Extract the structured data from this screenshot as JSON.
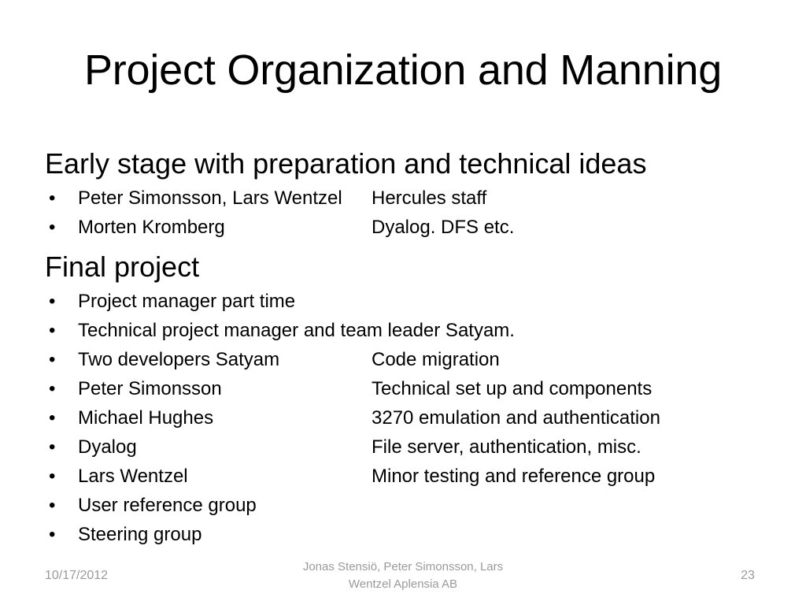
{
  "slide": {
    "title": "Project Organization and Manning",
    "sections": [
      {
        "heading": "Early stage with preparation and technical ideas",
        "bullets": [
          {
            "bullet": "•",
            "col_a": "Peter Simonsson, Lars Wentzel",
            "col_b": "Hercules staff"
          },
          {
            "bullet": "•",
            "col_a": "Morten Kromberg",
            "col_b": "Dyalog. DFS etc."
          }
        ]
      },
      {
        "heading": "Final project",
        "bullets": [
          {
            "bullet": "•",
            "col_a": "Project manager part time",
            "col_b": ""
          },
          {
            "bullet": "•",
            "col_a": "Technical project manager and team leader Satyam.",
            "col_b": ""
          },
          {
            "bullet": "•",
            "col_a": "Two developers Satyam",
            "col_b": "Code migration"
          },
          {
            "bullet": "•",
            "col_a": "Peter Simonsson",
            "col_b": "Technical set up and components"
          },
          {
            "bullet": "•",
            "col_a": "Michael Hughes",
            "col_b": "3270 emulation and authentication"
          },
          {
            "bullet": "•",
            "col_a": "Dyalog",
            "col_b": "File server, authentication, misc."
          },
          {
            "bullet": "•",
            "col_a": "Lars Wentzel",
            "col_b": "Minor testing and reference group"
          },
          {
            "bullet": "•",
            "col_a": "User reference group",
            "col_b": ""
          },
          {
            "bullet": "•",
            "col_a": "Steering group",
            "col_b": ""
          }
        ]
      }
    ],
    "footer": {
      "date": "10/17/2012",
      "center": "Jonas Stensiö, Peter Simonsson, Lars Wentzel  Aplensia AB",
      "page_number": "23"
    },
    "colors": {
      "background": "#ffffff",
      "text": "#000000",
      "footer_text": "#9a9a9a"
    }
  }
}
